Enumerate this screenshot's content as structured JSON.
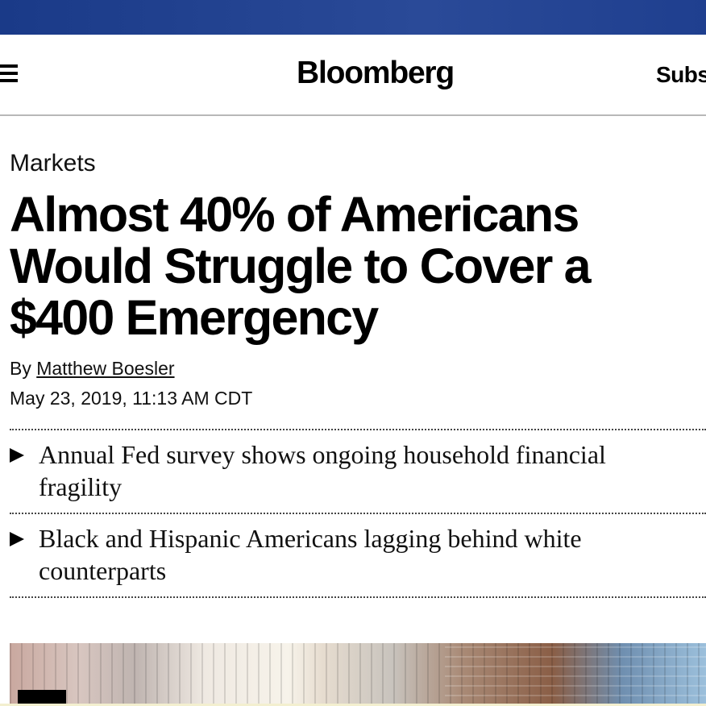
{
  "header": {
    "logo": "Bloomberg",
    "subscribe_label": "Subs"
  },
  "article": {
    "section": "Markets",
    "headline": "Almost 40% of Americans Would Struggle to Cover a $400 Emergency",
    "byline_prefix": "By",
    "author": "Matthew Boesler",
    "date": "May 23, 2019, 11:13 AM CDT",
    "bullets": [
      "Annual Fed survey shows ongoing household financial fragility",
      "Black and Hispanic Americans lagging behind white counterparts"
    ]
  },
  "colors": {
    "top_band": "#1f3f8f",
    "text": "#000000",
    "divider": "#444444"
  },
  "icons": {
    "menu": "hamburger-menu-icon",
    "bullet": "play-triangle-icon"
  }
}
